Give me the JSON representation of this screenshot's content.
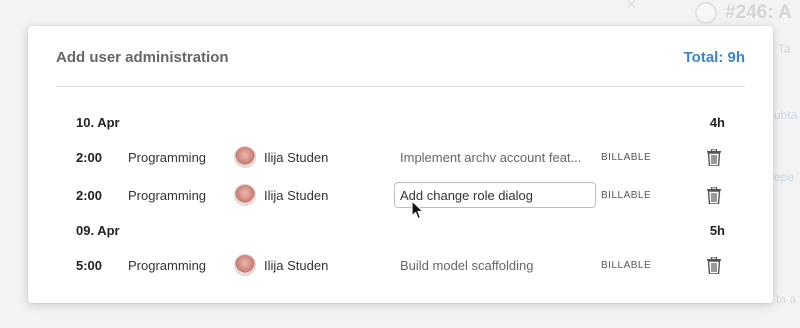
{
  "background": {
    "issue_title": "#246: A",
    "side_text_1": "Ta",
    "side_text_2": "ubta",
    "side_text_3": "epe",
    "side_text_4": "ta a"
  },
  "modal": {
    "title": "Add user administration",
    "total": "Total: 9h",
    "accent_color": "#3a86c8"
  },
  "days": [
    {
      "date": "10. Apr",
      "total": "4h",
      "entries": [
        {
          "time": "2:00",
          "type": "Programming",
          "user": "Ilija Studen",
          "description": "Implement archv account feat...",
          "billable": "BILLABLE",
          "editing": false
        },
        {
          "time": "2:00",
          "type": "Programming",
          "user": "Ilija Studen",
          "description": "Add change role dialog",
          "billable": "BILLABLE",
          "editing": true
        }
      ]
    },
    {
      "date": "09. Apr",
      "total": "5h",
      "entries": [
        {
          "time": "5:00",
          "type": "Programming",
          "user": "Ilija Studen",
          "description": "Build model scaffolding",
          "billable": "BILLABLE",
          "editing": false
        }
      ]
    }
  ],
  "icons": {
    "delete": "trash-icon",
    "cursor": "mouse-pointer-icon"
  }
}
